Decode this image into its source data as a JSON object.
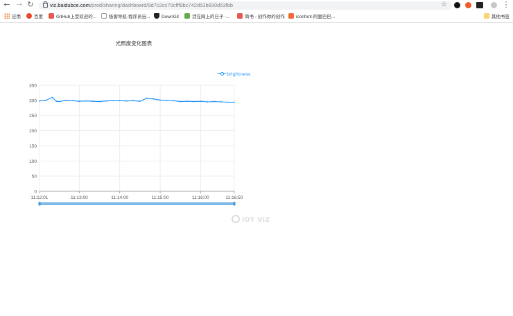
{
  "browser": {
    "url_host": "viz.baidubce.com",
    "url_path": "/prod/sharing/dashboard/9d7c2cc70cfff9bc742d53b830d53fbb",
    "bookmarks": [
      {
        "label": "应用",
        "icon": "apps-grid-icon"
      },
      {
        "label": "百度",
        "icon": "baidu-icon",
        "color": "#e8472b"
      },
      {
        "label": "GitHub上受欢迎的...",
        "icon": "bookmark-favicon-icon",
        "color": "#e55a4f"
      },
      {
        "label": "极客导航-程序员自...",
        "icon": "jike-icon",
        "color": "#333333"
      },
      {
        "label": "DownGit",
        "icon": "downgit-icon",
        "color": "#333333"
      },
      {
        "label": "活在网上的日子 -...",
        "icon": "j-icon",
        "color": "#6aa84f"
      },
      {
        "label": "简书 - 创作你的创作",
        "icon": "jianshu-icon",
        "color": "#e55a4f"
      },
      {
        "label": "iconfont-阿里巴巴...",
        "icon": "iconfont-icon",
        "color": "#f06a35"
      }
    ],
    "other_bookmarks": "其他书签"
  },
  "chart_title": "光照度变化图表",
  "watermark": "IOT VIZ",
  "colors": {
    "series": "#1890ff",
    "slider": "#7cb9e8"
  },
  "chart_data": {
    "type": "line",
    "title": "光照度变化图表",
    "xlabel": "",
    "ylabel": "",
    "ylim": [
      0,
      350
    ],
    "yticks": [
      "0",
      "50",
      "100",
      "150",
      "200",
      "250",
      "300",
      "350"
    ],
    "xticks": [
      "11:12:01",
      "11:13:00",
      "11:14:00",
      "11:15:00",
      "11:16:00",
      "11:16:50"
    ],
    "xrange": [
      "11:12:01",
      "11:16:50"
    ],
    "legend_position": "top-right",
    "grid": true,
    "series": [
      {
        "name": "brightness",
        "x": [
          "11:12:01",
          "11:12:10",
          "11:12:20",
          "11:12:26",
          "11:12:30",
          "11:12:40",
          "11:12:50",
          "11:13:00",
          "11:13:10",
          "11:13:20",
          "11:13:30",
          "11:13:40",
          "11:13:50",
          "11:14:00",
          "11:14:10",
          "11:14:20",
          "11:14:30",
          "11:14:35",
          "11:14:40",
          "11:14:50",
          "11:15:00",
          "11:15:10",
          "11:15:20",
          "11:15:30",
          "11:15:40",
          "11:15:50",
          "11:16:00",
          "11:16:10",
          "11:16:20",
          "11:16:30",
          "11:16:40",
          "11:16:50"
        ],
        "values": [
          298,
          300,
          310,
          297,
          296,
          300,
          299,
          297,
          298,
          297,
          296,
          298,
          299,
          299,
          298,
          299,
          297,
          302,
          307,
          305,
          301,
          300,
          299,
          296,
          297,
          296,
          297,
          295,
          296,
          295,
          294,
          294
        ]
      }
    ],
    "data_zoom": [
      0,
      1
    ]
  }
}
